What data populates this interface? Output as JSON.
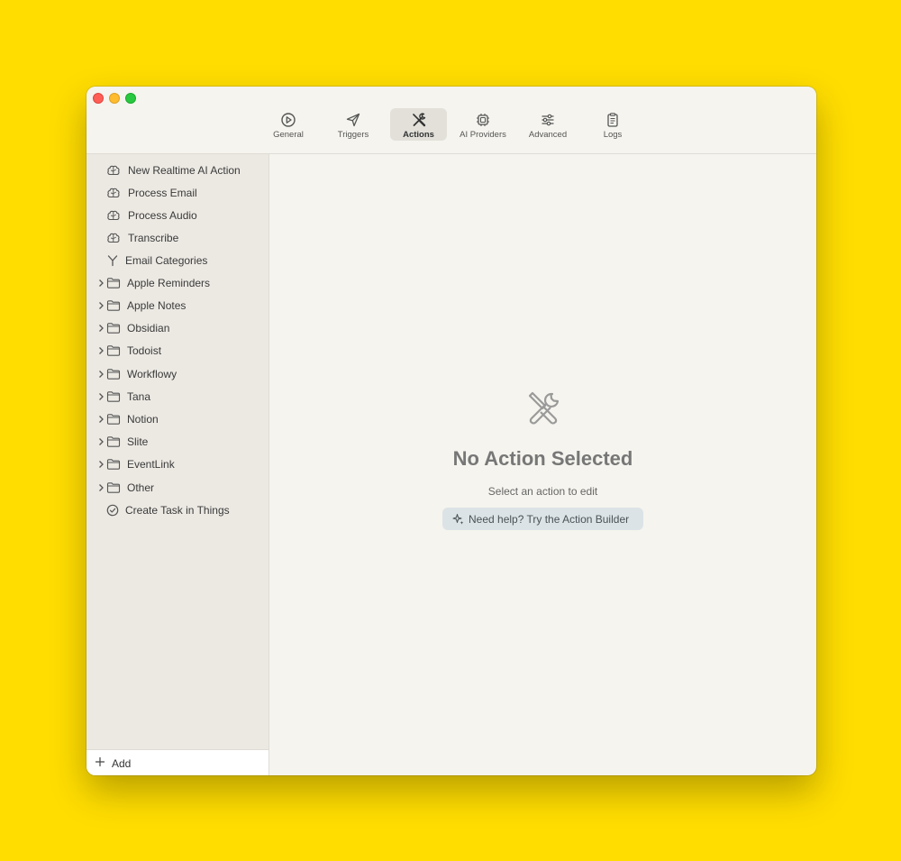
{
  "toolbar": {
    "tabs": [
      {
        "label": "General",
        "icon": "play-circle-icon"
      },
      {
        "label": "Triggers",
        "icon": "paper-plane-icon"
      },
      {
        "label": "Actions",
        "icon": "tools-icon",
        "active": true
      },
      {
        "label": "AI Providers",
        "icon": "cpu-chip-icon"
      },
      {
        "label": "Advanced",
        "icon": "sliders-icon"
      },
      {
        "label": "Logs",
        "icon": "clipboard-icon"
      }
    ]
  },
  "sidebar": {
    "items": [
      {
        "label": "New Realtime AI Action",
        "icon": "brain-icon"
      },
      {
        "label": "Process Email",
        "icon": "brain-icon"
      },
      {
        "label": "Process Audio",
        "icon": "brain-icon"
      },
      {
        "label": "Transcribe",
        "icon": "brain-icon"
      },
      {
        "label": "Email Categories",
        "icon": "branch-icon"
      },
      {
        "label": "Apple Reminders",
        "icon": "folder-icon",
        "expandable": true
      },
      {
        "label": "Apple Notes",
        "icon": "folder-icon",
        "expandable": true
      },
      {
        "label": "Obsidian",
        "icon": "folder-icon",
        "expandable": true
      },
      {
        "label": "Todoist",
        "icon": "folder-icon",
        "expandable": true
      },
      {
        "label": "Workflowy",
        "icon": "folder-icon",
        "expandable": true
      },
      {
        "label": "Tana",
        "icon": "folder-icon",
        "expandable": true
      },
      {
        "label": "Notion",
        "icon": "folder-icon",
        "expandable": true
      },
      {
        "label": "Slite",
        "icon": "folder-icon",
        "expandable": true
      },
      {
        "label": "EventLink",
        "icon": "folder-icon",
        "expandable": true
      },
      {
        "label": "Other",
        "icon": "folder-icon",
        "expandable": true
      },
      {
        "label": "Create Task in Things",
        "icon": "check-circle-icon"
      }
    ],
    "add_label": "Add"
  },
  "main": {
    "empty_icon": "tools-icon",
    "title": "No Action Selected",
    "subtitle": "Select an action to edit",
    "help_button": "Need help? Try the Action Builder"
  },
  "colors": {
    "background": "#FFDD00",
    "window": "#F5F4EE",
    "sidebar": "#ECE9E3",
    "help_button": "#DCE3E6"
  }
}
